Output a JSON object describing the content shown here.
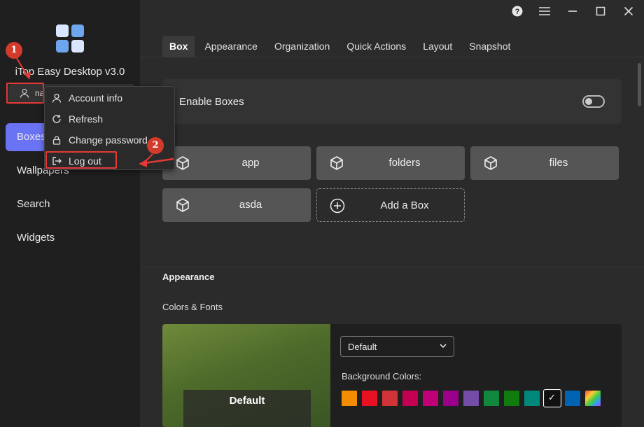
{
  "app": {
    "title": "iTop Easy Desktop v3.0",
    "user_name": "na"
  },
  "window_controls": [
    "help-icon",
    "menu-icon",
    "minimize-icon",
    "maximize-icon",
    "close-icon"
  ],
  "sidebar": {
    "items": [
      {
        "label": "Boxes",
        "active": true
      },
      {
        "label": "Wallpapers",
        "active": false
      },
      {
        "label": "Search",
        "active": false
      },
      {
        "label": "Widgets",
        "active": false
      }
    ]
  },
  "account_menu": {
    "items": [
      {
        "label": "Account info",
        "icon": "user-icon"
      },
      {
        "label": "Refresh",
        "icon": "refresh-icon"
      },
      {
        "label": "Change password",
        "icon": "lock-icon"
      },
      {
        "label": "Log out",
        "icon": "logout-icon"
      }
    ]
  },
  "annotations": {
    "step1": "1",
    "step2": "2"
  },
  "tabs": [
    {
      "label": "Box",
      "active": true
    },
    {
      "label": "Appearance",
      "active": false
    },
    {
      "label": "Organization",
      "active": false
    },
    {
      "label": "Quick Actions",
      "active": false
    },
    {
      "label": "Layout",
      "active": false
    },
    {
      "label": "Snapshot",
      "active": false
    }
  ],
  "box_settings": {
    "enable_label": "Enable Boxes",
    "enabled": false,
    "boxes": [
      "app",
      "folders",
      "files",
      "asda"
    ],
    "add_label": "Add a Box"
  },
  "appearance": {
    "section_title": "Appearance",
    "subsection_title": "Colors & Fonts",
    "preview_label": "Default",
    "theme_select": "Default",
    "bg_colors_label": "Background Colors:",
    "swatches": [
      "#f28c00",
      "#e81123",
      "#d13438",
      "#c30052",
      "#bf0077",
      "#9a0089",
      "#744da9",
      "#10893e",
      "#107c10",
      "#00897b",
      "#111111",
      "#0063b1"
    ],
    "selected_swatch_index": 10
  },
  "colors": {
    "accent": "#6b73f5",
    "annotation_red": "#e53935"
  }
}
